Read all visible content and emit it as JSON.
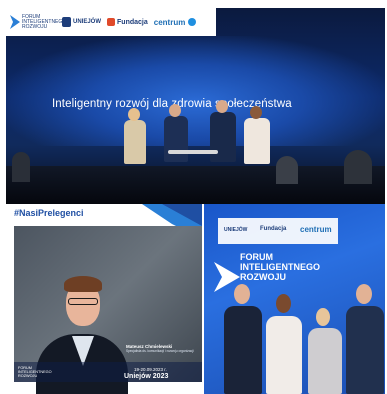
{
  "top_photo": {
    "logos": {
      "forum_logo_text": "FORUM INTELIGENTNEGO ROZWOJU",
      "uniejow_label": "UNIEJÓW",
      "fundacja_label": "Fundacja",
      "centrum_label": "centrum"
    },
    "headline": "Inteligentny rozwój dla zdrowia społeczeństwa"
  },
  "speaker_card": {
    "hashtag": "#NasiPrelegenci",
    "speaker_name": "Mateusz Chmielewski",
    "speaker_role": "Specjalista ds. komunikacji i rozwoju organizacji",
    "footer_logo": "FORUM INTELIGENTNEGO ROZWOJU",
    "dates": "19-20.09.2023 r.",
    "city": "Uniejów 2023"
  },
  "group_photo": {
    "logos": {
      "uniejow_label": "UNIEJÓW",
      "fundacja_label": "Fundacja",
      "centrum_label": "centrum"
    },
    "forum_title_line1": "FORUM",
    "forum_title_line2": "INTELIGENTNEGO",
    "forum_title_line3": "ROZWOJU"
  },
  "colors": {
    "brand_blue": "#1f4fa3",
    "stage_blue": "#0d2a6b",
    "panel_blue": "#2a6fe0"
  }
}
